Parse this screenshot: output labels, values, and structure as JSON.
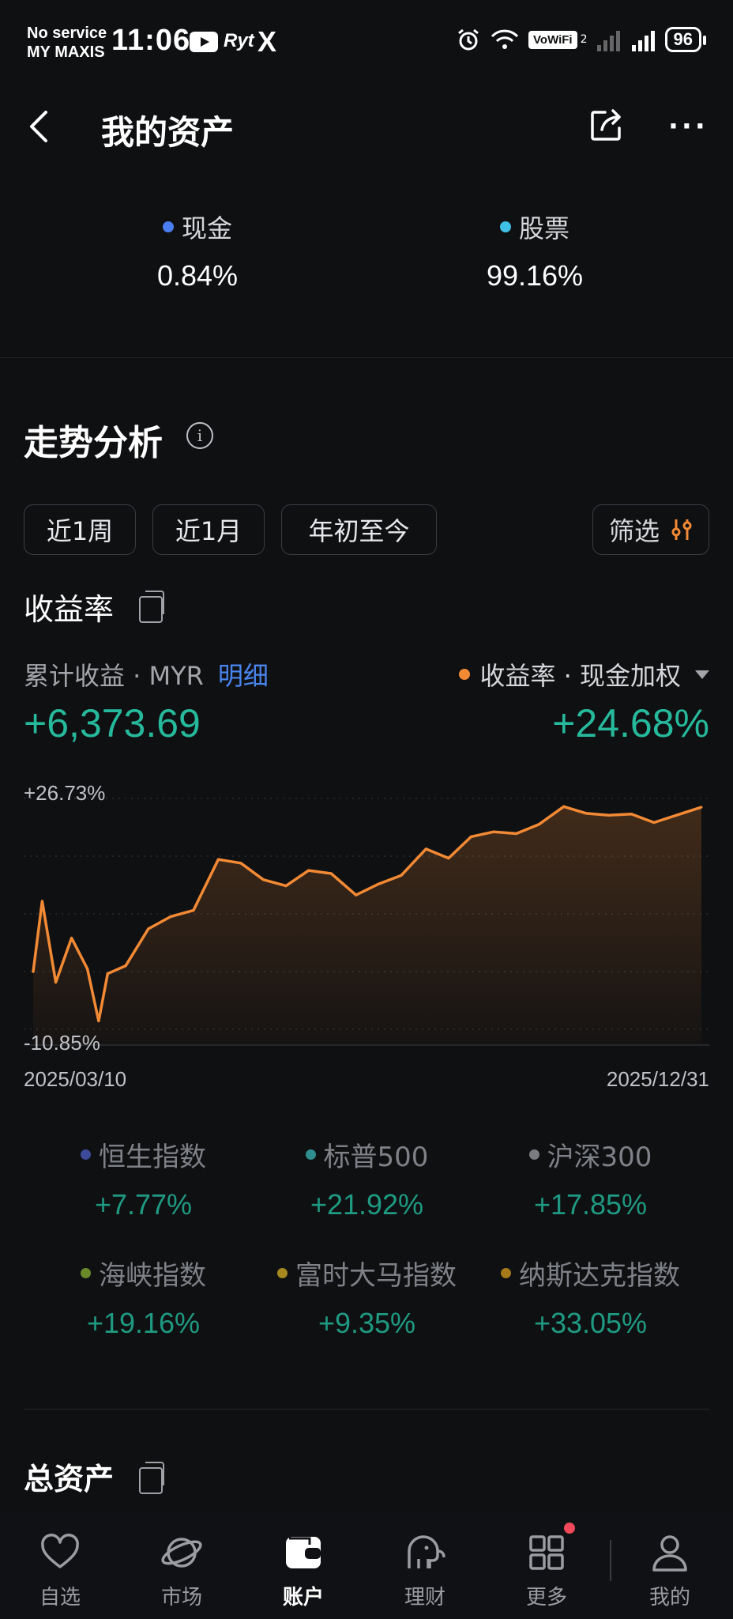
{
  "status_bar": {
    "carrier_line1": "No service",
    "carrier_line2": "MY MAXIS",
    "time": "11:06",
    "app_label": "Ryt",
    "x_label": "X",
    "vowifi": "VoWiFi",
    "sim2": "2",
    "battery": "96"
  },
  "header": {
    "title": "我的资产",
    "more": "···"
  },
  "allocation": [
    {
      "label": "现金",
      "value": "0.84%",
      "color": "#4a7ef0"
    },
    {
      "label": "股票",
      "value": "99.16%",
      "color": "#3fc0e6"
    }
  ],
  "trend": {
    "title": "走势分析",
    "info": "i",
    "ranges": [
      "近1周",
      "近1月",
      "年初至今"
    ],
    "filter": "筛选",
    "subtitle": "收益率",
    "cum_label": "累计收益 · MYR",
    "detail_link": "明细",
    "return_label": "收益率 · 现金加权",
    "cum_value": "+6,373.69",
    "return_value": "+24.68%"
  },
  "chart_data": {
    "type": "area",
    "ylim": [
      -10.85,
      26.73
    ],
    "y_tick_labels": [
      "+26.73%",
      "-10.85%"
    ],
    "x_start": "2025/03/10",
    "x_end": "2025/12/31",
    "line_color": "#f28a35",
    "x": [
      "2025/03/10",
      "2025/03/14",
      "2025/03/20",
      "2025/03/27",
      "2025/04/03",
      "2025/04/08",
      "2025/04/12",
      "2025/04/20",
      "2025/04/30",
      "2025/05/10",
      "2025/05/20",
      "2025/05/31",
      "2025/06/10",
      "2025/06/20",
      "2025/06/30",
      "2025/07/10",
      "2025/07/20",
      "2025/07/31",
      "2025/08/10",
      "2025/08/20",
      "2025/08/31",
      "2025/09/10",
      "2025/09/20",
      "2025/09/30",
      "2025/10/10",
      "2025/10/20",
      "2025/10/31",
      "2025/11/10",
      "2025/11/20",
      "2025/11/30",
      "2025/12/10",
      "2025/12/20",
      "2025/12/31"
    ],
    "values": [
      -1.5,
      10.0,
      -3.2,
      4.0,
      -1.0,
      -9.5,
      -1.8,
      -0.5,
      5.5,
      7.5,
      8.5,
      16.8,
      16.2,
      13.5,
      12.5,
      15.0,
      14.5,
      11.0,
      12.8,
      14.2,
      18.5,
      17.0,
      20.5,
      21.3,
      21.0,
      22.5,
      25.4,
      24.3,
      24.0,
      24.2,
      22.8,
      24.0,
      25.3
    ]
  },
  "benchmarks": [
    {
      "name": "恒生指数",
      "value": "+7.77%",
      "color": "#3d4a9a"
    },
    {
      "name": "标普500",
      "value": "+21.92%",
      "color": "#2f8f8f"
    },
    {
      "name": "沪深300",
      "value": "+17.85%",
      "color": "#7a7c82"
    },
    {
      "name": "海峡指数",
      "value": "+19.16%",
      "color": "#6a8a2a"
    },
    {
      "name": "富时大马指数",
      "value": "+9.35%",
      "color": "#a68a1f"
    },
    {
      "name": "纳斯达克指数",
      "value": "+33.05%",
      "color": "#a77a1a"
    }
  ],
  "total_assets_title": "总资产",
  "tabs": [
    {
      "label": "自选",
      "icon": "heart-icon"
    },
    {
      "label": "市场",
      "icon": "planet-icon"
    },
    {
      "label": "账户",
      "icon": "wallet-icon",
      "active": true
    },
    {
      "label": "理财",
      "icon": "elephant-icon"
    },
    {
      "label": "更多",
      "icon": "grid-icon"
    },
    {
      "label": "我的",
      "icon": "user-icon"
    }
  ]
}
